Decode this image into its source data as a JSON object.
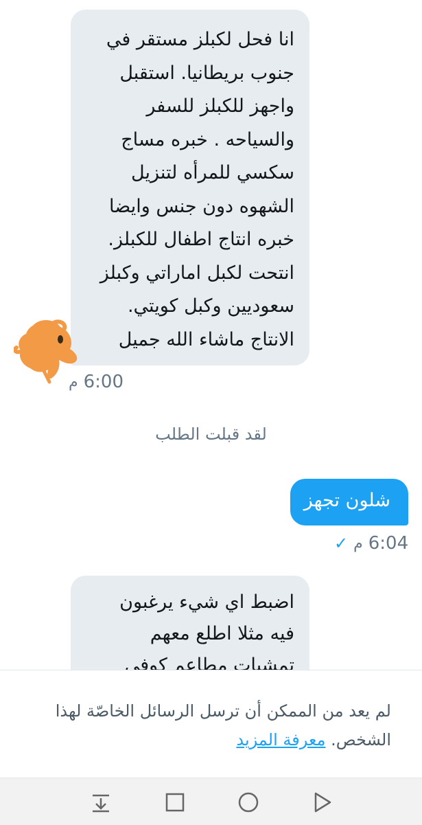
{
  "messages": [
    {
      "direction": "received",
      "lines": [
        "انا فحل لكبلز مستقر في",
        "جنوب بريطانيا. استقبل",
        "واجهز للكبلز للسفر",
        "والسياحه . خبره مساج",
        "سكسي للمرأه لتنزيل",
        "الشهوه دون جنس وايضا",
        "خبره انتاج اطفال للكبلز.",
        "انتحت لكبل اماراتي وكبلز",
        "سعوديين وكبل كويتي.",
        "الانتاج ماشاء الله جميل"
      ],
      "time": "6:00",
      "ampm": "م"
    },
    {
      "direction": "system",
      "text": "لقد قبلت الطلب"
    },
    {
      "direction": "sent",
      "text": "شلون تجهز",
      "time": "6:04",
      "ampm": "م",
      "status_icon": "checkmark-icon"
    },
    {
      "direction": "received",
      "lines": [
        "اضبط اي شيء يرغبون",
        "فيه مثلا اطلع معهم",
        "تمشيات مطاعم كوفي"
      ]
    }
  ],
  "notice": {
    "text": "لم يعد من الممكن أن ترسل الرسائل الخاصّة لهذا الشخص.",
    "link": "معرفة المزيد"
  },
  "navbar": {
    "icons": [
      "collapse-down-icon",
      "recents-square-icon",
      "home-circle-icon",
      "back-triangle-icon"
    ]
  },
  "colors": {
    "received_bubble": "#e6ecf0",
    "sent_bubble": "#1da1f2",
    "link": "#1da1f2",
    "avatar_scribble": "#f39a47"
  }
}
